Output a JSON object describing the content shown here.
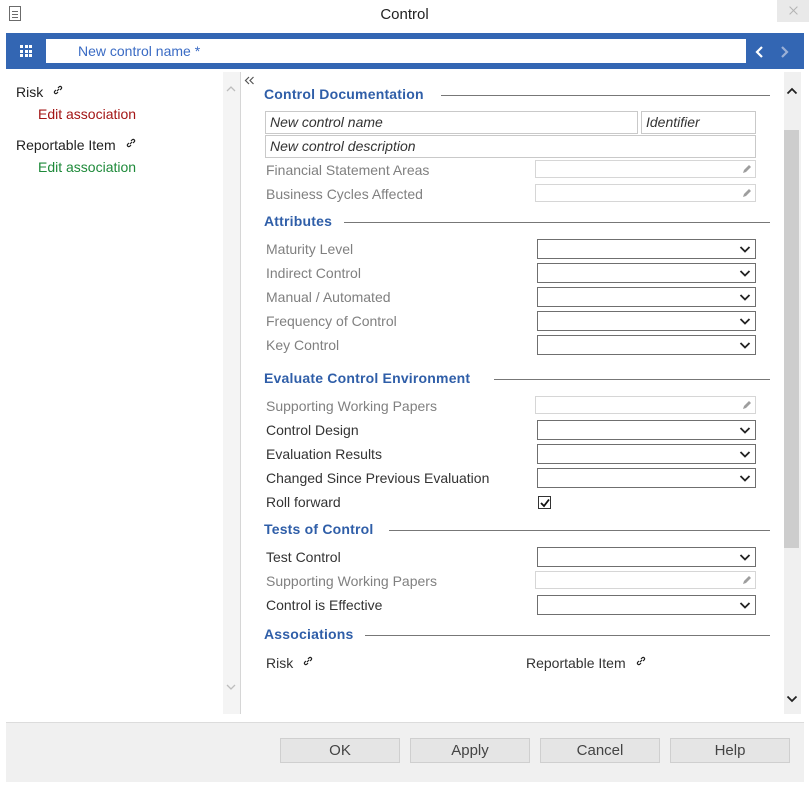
{
  "window": {
    "title": "Control"
  },
  "header": {
    "name_value": "New control name *"
  },
  "left_panel": {
    "items": [
      {
        "label": "Risk",
        "link": "Edit association",
        "link_color": "#a31515"
      },
      {
        "label": "Reportable Item",
        "link": "Edit association",
        "link_color": "#1e8a3a"
      }
    ]
  },
  "sections": {
    "control_documentation": {
      "title": "Control Documentation",
      "name_placeholder": "New control name",
      "identifier_placeholder": "Identifier",
      "description_placeholder": "New control description",
      "financial_statement_areas": "Financial Statement Areas",
      "business_cycles_affected": "Business Cycles Affected"
    },
    "attributes": {
      "title": "Attributes",
      "maturity_level": "Maturity Level",
      "indirect_control": "Indirect Control",
      "manual_automated": "Manual / Automated",
      "frequency_of_control": "Frequency of Control",
      "key_control": "Key Control"
    },
    "evaluate": {
      "title": "Evaluate Control Environment",
      "supporting_working_papers": "Supporting Working Papers",
      "control_design": "Control Design",
      "evaluation_results": "Evaluation Results",
      "changed_since": "Changed Since Previous Evaluation",
      "roll_forward": "Roll forward",
      "roll_forward_checked": true
    },
    "tests": {
      "title": "Tests of Control",
      "test_control": "Test Control",
      "supporting_working_papers": "Supporting Working Papers",
      "control_is_effective": "Control is Effective"
    },
    "associations": {
      "title": "Associations",
      "risk": "Risk",
      "reportable_item": "Reportable Item"
    }
  },
  "footer": {
    "ok": "OK",
    "apply": "Apply",
    "cancel": "Cancel",
    "help": "Help"
  },
  "colors": {
    "accent": "#3366b3",
    "section_title": "#2f5ea8",
    "risk_link": "#a31515",
    "reportable_link": "#1e8a3a"
  },
  "icons": [
    "document-icon",
    "close-icon",
    "grid-menu-icon",
    "chevron-left-icon",
    "chevron-right-icon",
    "link-icon",
    "collapse-icon",
    "chevron-down-icon",
    "pencil-icon",
    "checkmark-icon",
    "scroll-up-icon",
    "scroll-down-icon"
  ]
}
